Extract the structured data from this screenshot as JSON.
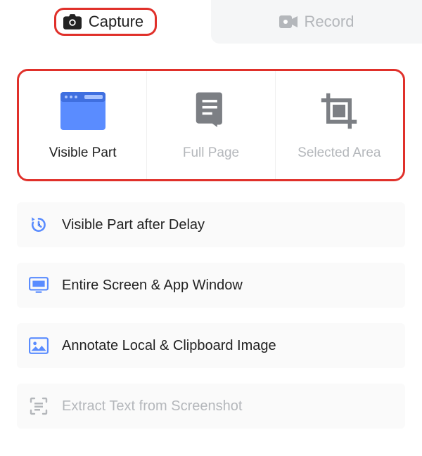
{
  "colors": {
    "highlight_border": "#e0302a",
    "accent_blue": "#5a8cff",
    "muted_text": "#b4b7bb",
    "row_bg": "#fafafa"
  },
  "tabs": {
    "capture": {
      "label": "Capture",
      "active": true
    },
    "record": {
      "label": "Record",
      "active": false
    }
  },
  "modes": {
    "visible": {
      "label": "Visible Part",
      "active": true
    },
    "fullpage": {
      "label": "Full Page",
      "active": false
    },
    "selected": {
      "label": "Selected Area",
      "active": false
    }
  },
  "rows": {
    "delay": {
      "label": "Visible Part after Delay",
      "enabled": true
    },
    "entire": {
      "label": "Entire Screen & App Window",
      "enabled": true
    },
    "annotate": {
      "label": "Annotate Local & Clipboard Image",
      "enabled": true
    },
    "ocr": {
      "label": "Extract Text from Screenshot",
      "enabled": false
    }
  }
}
